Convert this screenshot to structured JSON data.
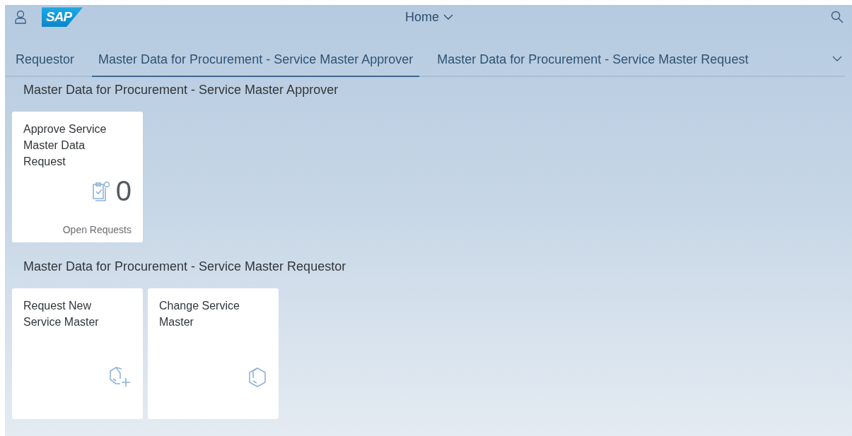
{
  "shell": {
    "logo": "SAP",
    "title": "Home"
  },
  "tabs": [
    {
      "label": "Requestor",
      "selected": false
    },
    {
      "label": "Master Data for Procurement - Service Master Approver",
      "selected": true
    },
    {
      "label": "Master Data for Procurement - Service Master Request",
      "selected": false
    }
  ],
  "groups": [
    {
      "title": "Master Data for Procurement - Service Master Approver",
      "tiles": [
        {
          "kind": "kpi",
          "title": "Approve Service Master Data Request",
          "value": "0",
          "footer": "Open Requests"
        }
      ]
    },
    {
      "title": "Master Data for Procurement - Service Master Requestor",
      "tiles": [
        {
          "kind": "create",
          "title": "Request New Service Master"
        },
        {
          "kind": "change",
          "title": "Change Service Master"
        }
      ]
    }
  ]
}
